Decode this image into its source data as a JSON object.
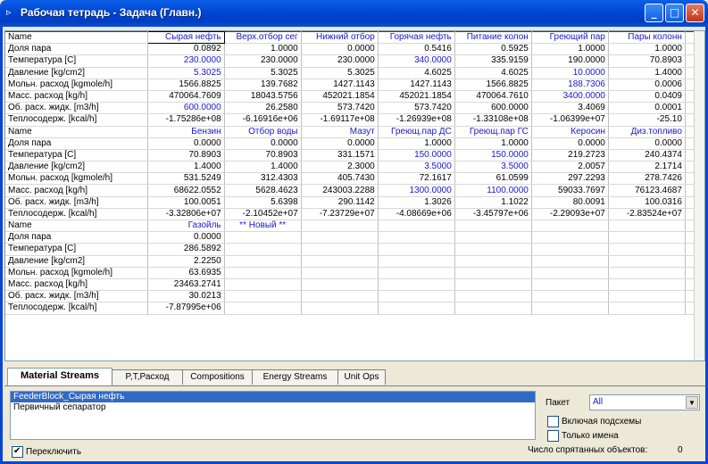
{
  "window": {
    "title": "Рабочая тетрадь - Задача (Главн.)",
    "icon": "workbook-icon",
    "buttons": {
      "minimize": "_",
      "maximize": "□",
      "close": "✕"
    }
  },
  "labels": [
    "Name",
    "Доля пара",
    "Температура [C]",
    "Давление [kg/cm2]",
    "Мольн. расход [kgmole/h]",
    "Масс. расход [kg/h]",
    "Об. расх. жидк. [m3/h]",
    "Теплосодерж. [kcal/h]"
  ],
  "blocks": [
    {
      "streams": [
        "Сырая нефть",
        "Верх.отбор сег",
        "Нижний отбор",
        "Горячая нефть",
        "Питание колон",
        "Греющий пар",
        "Пары колонн"
      ],
      "rows": [
        [
          "0.0892",
          "1.0000",
          "0.0000",
          "0.5416",
          "0.5925",
          "1.0000",
          "1.0000"
        ],
        [
          "230.0000",
          "230.0000",
          "230.0000",
          "340.0000",
          "335.9159",
          "190.0000",
          "70.8903"
        ],
        [
          "5.3025",
          "5.3025",
          "5.3025",
          "4.6025",
          "4.6025",
          "10.0000",
          "1.4000"
        ],
        [
          "1566.8825",
          "139.7682",
          "1427.1143",
          "1427.1143",
          "1566.8825",
          "188.7306",
          "0.0006"
        ],
        [
          "470064.7609",
          "18043.5756",
          "452021.1854",
          "452021.1854",
          "470064.7610",
          "3400.0000",
          "0.0409"
        ],
        [
          "600.0000",
          "26.2580",
          "573.7420",
          "573.7420",
          "600.0000",
          "3.4069",
          "0.0001"
        ],
        [
          "-1.75286e+08",
          "-6.16916e+06",
          "-1.69117e+08",
          "-1.26939e+08",
          "-1.33108e+08",
          "-1.06399e+07",
          "-25.10"
        ]
      ],
      "blue": [
        [
          1,
          0
        ],
        [
          2,
          0
        ],
        [
          1,
          3
        ],
        [
          2,
          5
        ],
        [
          3,
          5
        ],
        [
          4,
          5
        ],
        [
          5,
          0
        ]
      ]
    },
    {
      "streams": [
        "Бензин",
        "Отбор воды",
        "Мазут",
        "Греющ.пар ДС",
        "Греющ.пар ГС",
        "Керосин",
        "Диз.топливо"
      ],
      "rows": [
        [
          "0.0000",
          "0.0000",
          "0.0000",
          "1.0000",
          "1.0000",
          "0.0000",
          "0.0000"
        ],
        [
          "70.8903",
          "70.8903",
          "331.1571",
          "150.0000",
          "150.0000",
          "219.2723",
          "240.4374"
        ],
        [
          "1.4000",
          "1.4000",
          "2.3000",
          "3.5000",
          "3.5000",
          "2.0057",
          "2.1714"
        ],
        [
          "531.5249",
          "312.4303",
          "405.7430",
          "72.1617",
          "61.0599",
          "297.2293",
          "278.7426"
        ],
        [
          "68622.0552",
          "5628.4623",
          "243003.2288",
          "1300.0000",
          "1100.0000",
          "59033.7697",
          "76123.4687"
        ],
        [
          "100.0051",
          "5.6398",
          "290.1142",
          "1.3026",
          "1.1022",
          "80.0091",
          "100.0316"
        ],
        [
          "-3.32806e+07",
          "-2.10452e+07",
          "-7.23729e+07",
          "-4.08669e+06",
          "-3.45797e+06",
          "-2.29093e+07",
          "-2.83524e+07"
        ]
      ],
      "blue": [
        [
          1,
          3
        ],
        [
          1,
          4
        ],
        [
          2,
          3
        ],
        [
          2,
          4
        ],
        [
          4,
          3
        ],
        [
          4,
          4
        ]
      ]
    },
    {
      "streams": [
        "Газойль",
        "** Новый **",
        "",
        "",
        "",
        "",
        ""
      ],
      "rows": [
        [
          "0.0000",
          "",
          "",
          "",
          "",
          "",
          ""
        ],
        [
          "286.5892",
          "",
          "",
          "",
          "",
          "",
          ""
        ],
        [
          "2.2250",
          "",
          "",
          "",
          "",
          "",
          ""
        ],
        [
          "63.6935",
          "",
          "",
          "",
          "",
          "",
          ""
        ],
        [
          "23463.2741",
          "",
          "",
          "",
          "",
          "",
          ""
        ],
        [
          "30.0213",
          "",
          "",
          "",
          "",
          "",
          ""
        ],
        [
          "-7.87995e+06",
          "",
          "",
          "",
          "",
          "",
          ""
        ]
      ],
      "blue": []
    }
  ],
  "tabs": [
    "Material Streams",
    "P,T,Расход",
    "Compositions",
    "Energy Streams",
    "Unit Ops"
  ],
  "active_tab": "Material Streams",
  "stream_list": [
    "FeederBlock_Сырая нефть",
    "Первичный сепаратор"
  ],
  "paket": {
    "label": "Пакет",
    "value": "All"
  },
  "checkboxes": {
    "include_subschemes": "Включая подсхемы",
    "names_only": "Только имена",
    "toggle": "Переключить"
  },
  "hidden": {
    "label": "Число спрятанных объектов:",
    "count": "0"
  },
  "colors": {
    "accent": "#1818d0",
    "selection": "#316ac5",
    "titlebar": "#0046d5"
  }
}
